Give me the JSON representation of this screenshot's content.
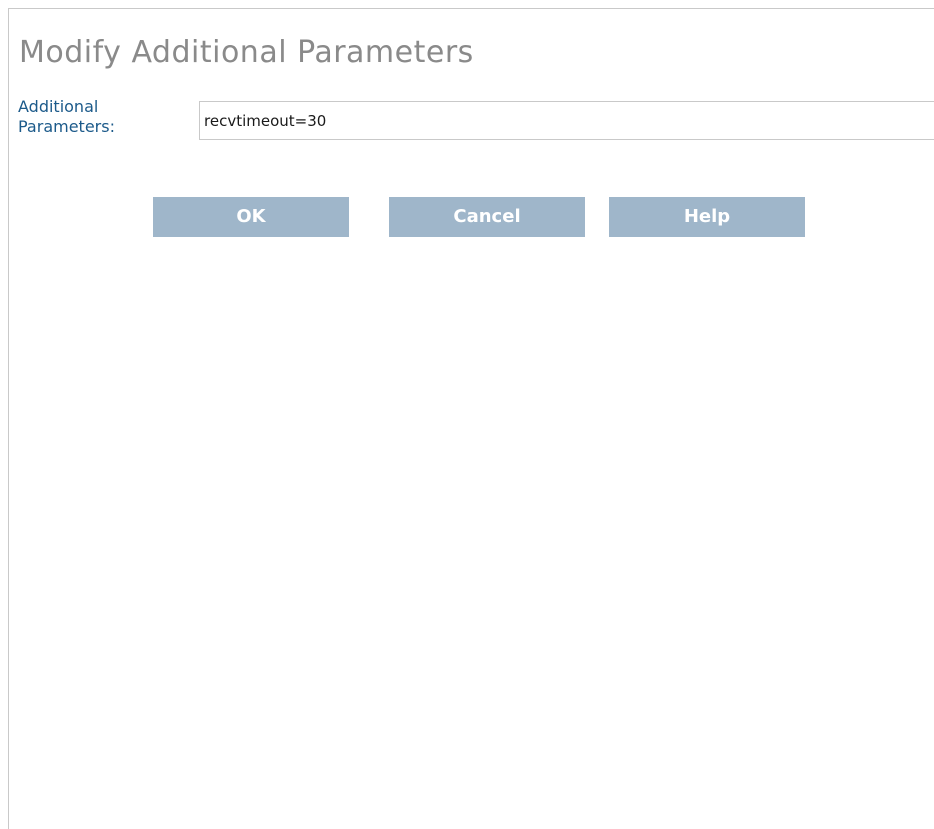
{
  "dialog": {
    "title": "Modify Additional Parameters"
  },
  "form": {
    "label": "Additional Parameters:",
    "value": "recvtimeout=30"
  },
  "buttons": {
    "ok": "OK",
    "cancel": "Cancel",
    "help": "Help"
  },
  "colors": {
    "title": "#8a8a8a",
    "label": "#1c5a8a",
    "button_bg": "#9fb6ca",
    "button_text": "#ffffff",
    "border": "#c9c9c9"
  }
}
